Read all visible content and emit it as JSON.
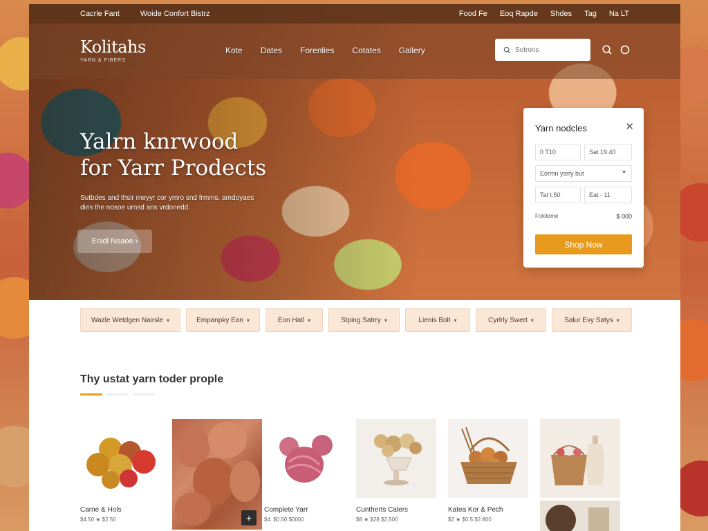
{
  "topbar": {
    "left": [
      "Cacrle Fant",
      "Woide Confort Bistrz"
    ],
    "right": [
      "Food Fe",
      "Eoq Rapde",
      "Shdes",
      "Tag",
      "Na LT"
    ]
  },
  "brand": {
    "name": "Kolitahs",
    "tagline": "YARN & FIBERS"
  },
  "nav": [
    "Kote",
    "Dates",
    "Forenlies",
    "Cotates",
    "Gallery"
  ],
  "search": {
    "placeholder": "Sotrons"
  },
  "hero": {
    "title_line1": "Yalrn knrwood",
    "title_line2": "for Yarr Prodects",
    "subtitle": "Sutbdes and thsir rneyyr cor ymro snd frmms. amdoyaes dies the nosoe urnsd ans vrdonedd.",
    "cta": "Enidl Noaoe"
  },
  "card": {
    "title": "Yarn nodcles",
    "field1": "0  T10",
    "field2": "Sat 19.40",
    "select": "Eormn ysrry but",
    "field3": "Tat t.50",
    "field4": "Eat - 11",
    "total_label": "Foloteme",
    "total_value": "$ 000",
    "button": "Shop Now"
  },
  "filters": [
    "Wazle Wetdgen Nairsle",
    "Empanpky Ean",
    "Eon Hatl",
    "Stping Satrry",
    "Lienis Bolt",
    "Cyrlrly Swert",
    "Salur Evy Satys"
  ],
  "section": {
    "title": "Thy ustat yarn toder prople"
  },
  "products": [
    {
      "name": "Carne & Hols",
      "price": "$4.50  ★ $2.50"
    },
    {
      "name": "",
      "price": ""
    },
    {
      "name": "Complete Yarr",
      "price": "$4.  $0.50  $0000"
    },
    {
      "name": "Cuntherts Calers",
      "price": "$8  ★  $28 $2,500"
    },
    {
      "name": "Katea Kor & Pech",
      "price": "$2 ★ $0.5 $2.800"
    },
    {
      "name": "",
      "price": ""
    }
  ],
  "colors": {
    "accent": "#e89a1c",
    "chip_bg": "#fbe7d6",
    "topbar": "#5c341a"
  }
}
